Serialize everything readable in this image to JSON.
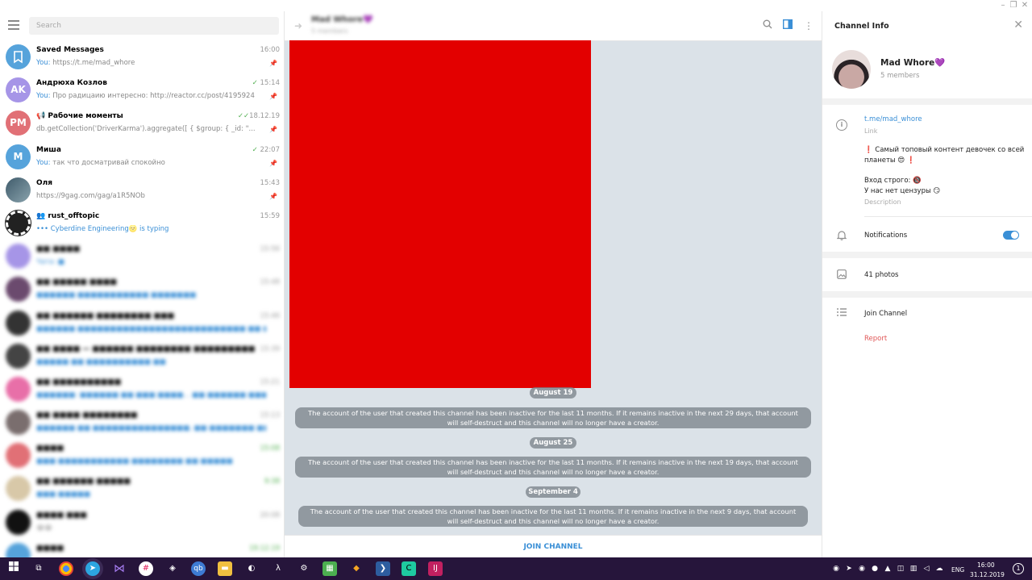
{
  "search": {
    "placeholder": "Search"
  },
  "chats": [
    {
      "name": "Saved Messages",
      "time": "16:00",
      "prefix": "You:",
      "message": "https://t.me/mad_whore",
      "avatar_text": "",
      "avatar_color": "#56a3db",
      "pinned": true
    },
    {
      "name": "Андрюха Козлов",
      "time": "15:14",
      "prefix": "You:",
      "message": "Про радицаию интересно: http://reactor.cc/post/4195924",
      "avatar_text": "AK",
      "avatar_color": "#a695e7",
      "pinned": true
    },
    {
      "name": "📢 Рабочие моменты",
      "time": "18.12.19",
      "prefix": "",
      "message": "db.getCollection('DriverKarma').aggregate([ {        $group: {        _id: \"...",
      "avatar_text": "PM",
      "avatar_color": "#e17076",
      "pinned": true
    },
    {
      "name": "Миша",
      "time": "22:07",
      "prefix": "You:",
      "message": "так что досматривай спокойно",
      "avatar_text": "M",
      "avatar_color": "#56a3db",
      "pinned": true
    },
    {
      "name": "Оля",
      "time": "15:43",
      "prefix": "",
      "message": "https://9gag.com/gag/a1R5NOb",
      "avatar_text": "",
      "avatar_color": "#5b7a8c",
      "pinned": true
    },
    {
      "name": "rust_offtopic",
      "time": "15:59",
      "prefix": "",
      "message": "••• Cyberdine Engineering🌝 is typing",
      "avatar_text": "",
      "avatar_color": "#222222",
      "pinned": false
    }
  ],
  "blurred_chats": [
    {
      "name": "■■ ■■■■",
      "time": "15:56",
      "message": "Чата: ■",
      "avatar_color": "#a695e7"
    },
    {
      "name": "■■ ■■■■■ ■■■■",
      "time": "15:48",
      "message": "■■■■■■ ■■■■■■■■■■■ ■■■■■■■",
      "avatar_color": "#6b4a6e"
    },
    {
      "name": "■■ ■■■■■■ ■■■■■■■■ ■■■",
      "time": "15:46",
      "message": "■■■■■■ ■■■■■■■■■■■■■■■■■■■■■■■■■■ ■■ ■■■■ ■■■■■■",
      "avatar_color": "#333333"
    },
    {
      "name": "■■ ■■■■ — ■■■■■■ ■■■■■■■■ ■■■■■■■■■",
      "time": "15:39",
      "message": "■■■■■ ■■ ■■■■■■■■■■ ■■",
      "avatar_color": "#444444"
    },
    {
      "name": "■■ ■■■■■■■■■■",
      "time": "15:21",
      "message": "■■■■■■: ■■■■■■ ■■ ■■■ ■■■■... ■■ ■■■■■■ ■■■ ■■■■■■■■ ■■■ ■■■■■■",
      "avatar_color": "#e86fa8"
    },
    {
      "name": "■■ ■■■■ ■■■■■■■■",
      "time": "15:13",
      "message": "■■■■■■ ■■ ■■■■■■■■■■■■■■■, ■■ ■■■■■■■ ■■■■■■■■■■■ ■■■■■■■ ■■■■",
      "avatar_color": "#7a6e6e"
    },
    {
      "name": "■■■■",
      "time": "15:08",
      "message": "■■■ ■■■■■■■■■■■ ■■■■■■■■ ■■ ■■■■■",
      "avatar_color": "#e17076"
    },
    {
      "name": "■■ ■■■■■■ ■■■■■",
      "time": "9:38",
      "message": "■■■ ■■■■■",
      "avatar_color": "#d8c8a8"
    },
    {
      "name": "■■■■ ■■■",
      "time": "20:08",
      "message": "😭😭",
      "avatar_color": "#111111"
    },
    {
      "name": "■■■■",
      "time": "19.12.19",
      "message": "",
      "avatar_color": "#56a3db"
    }
  ],
  "middle": {
    "title": "Mad Whore💜",
    "subtitle": "5 members",
    "media_color": "#e30000",
    "messages": [
      {
        "date": "August 19",
        "text": "The account of the user that created this channel has been inactive for the last 11 months. If it remains inactive in the next 29 days, that account will self-destruct and this channel will no longer have a creator."
      },
      {
        "date": "August 25",
        "text": "The account of the user that created this channel has been inactive for the last 11 months. If it remains inactive in the next 19 days, that account will self-destruct and this channel will no longer have a creator."
      },
      {
        "date": "September 4",
        "text": "The account of the user that created this channel has been inactive for the last 11 months. If it remains inactive in the next 9 days, that account will self-destruct and this channel will no longer have a creator."
      }
    ],
    "join_label": "JOIN CHANNEL"
  },
  "info": {
    "title": "Channel Info",
    "name": "Mad Whore💜",
    "members": "5 members",
    "link": "t.me/mad_whore",
    "link_label": "Link",
    "description_line1": "❗ Самый топовый контент девочек          со всей планеты 😍 ❗",
    "description_line2": "Вход строго: 🔞",
    "description_line3": "У нас нет цензуры 😏",
    "description_label": "Description",
    "notifications_label": "Notifications",
    "notifications_on": true,
    "photos_label": "41 photos",
    "join_label": "Join Channel",
    "report_label": "Report"
  },
  "taskbar": {
    "lang": "ENG",
    "time": "16:00",
    "date": "31.12.2019",
    "notification_count": "1"
  },
  "colors": {
    "accent": "#3a8fd6",
    "read_check": "#4fae4e",
    "taskbar_bg": "#26153b",
    "report": "#e05757"
  }
}
